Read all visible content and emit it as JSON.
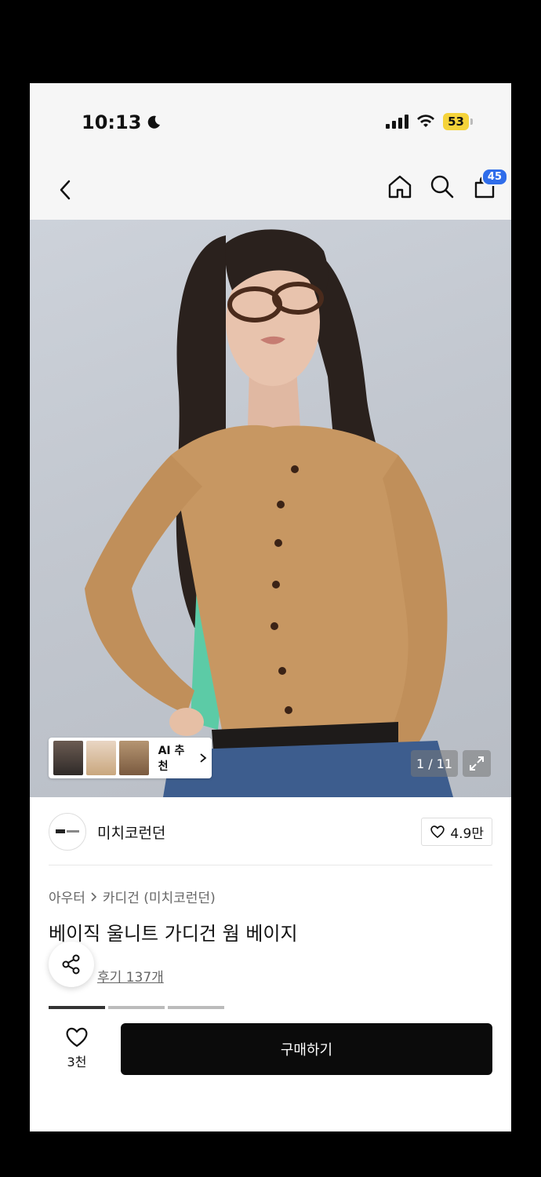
{
  "status_bar": {
    "time": "10:13",
    "battery": "53"
  },
  "nav": {
    "cart_badge": "45"
  },
  "hero": {
    "image_counter": "1 / 11",
    "ai_label": "AI 추천"
  },
  "brand": {
    "name": "미치코런던",
    "like_count": "4.9만"
  },
  "product": {
    "breadcrumb": [
      "아우터",
      "카디건 (미치코런던)"
    ],
    "title": "베이직 울니트 가디건 웜 베이지",
    "reviews": "후기 137개"
  },
  "bottom_bar": {
    "wish_count": "3천",
    "buy_label": "구매하기"
  },
  "colors": {
    "accent": "#2f6dea",
    "battery": "#f5d33a",
    "buy_button": "#0b0b0b"
  }
}
